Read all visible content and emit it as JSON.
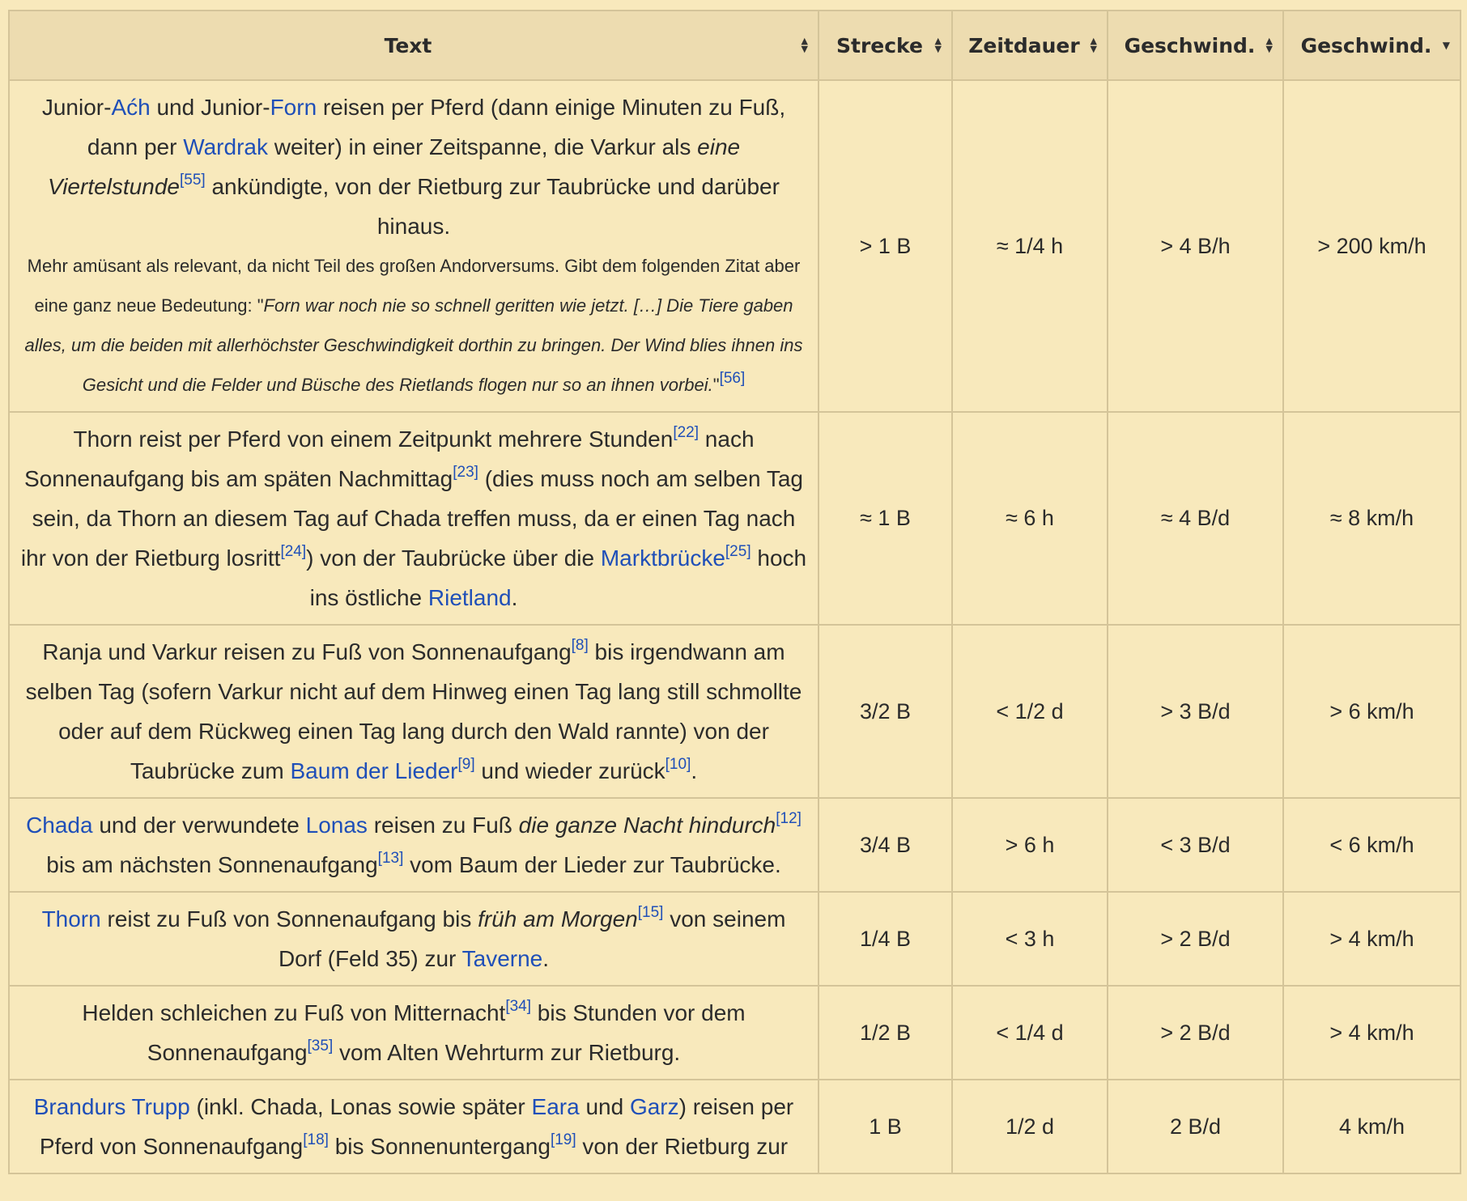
{
  "headers": [
    {
      "label": "Text",
      "sort": "both"
    },
    {
      "label": "Strecke",
      "sort": "both"
    },
    {
      "label": "Zeitdauer",
      "sort": "both"
    },
    {
      "label": "Geschwind.",
      "sort": "both"
    },
    {
      "label": "Geschwind.",
      "sort": "desc"
    }
  ],
  "sort_icons": {
    "both": "▲▼",
    "desc": "▼"
  },
  "rows": [
    {
      "text": [
        {
          "t": "Junior-"
        },
        {
          "t": "Aćh",
          "link": true
        },
        {
          "t": " und Junior-"
        },
        {
          "t": "Forn",
          "link": true
        },
        {
          "t": " reisen per Pferd (dann einige Minuten zu Fuß, dann per "
        },
        {
          "t": "Wardrak",
          "link": true
        },
        {
          "t": " weiter) in einer Zeitspanne, die Varkur als "
        },
        {
          "t": "eine Viertelstunde",
          "em": true
        },
        {
          "t": "[55]",
          "sup": true
        },
        {
          "t": " ankündigte, von der Rietburg zur Taubrücke und darüber hinaus."
        }
      ],
      "note": [
        {
          "t": "Mehr amüsant als relevant, da nicht Teil des großen Andorversums. Gibt dem folgenden Zitat aber eine ganz neue Bedeutung: \""
        },
        {
          "t": "Forn war noch nie so schnell geritten wie jetzt. […] Die Tiere gaben alles, um die beiden mit allerhöchster Geschwindigkeit dorthin zu bringen. Der Wind blies ihnen ins Gesicht und die Felder und Büsche des Rietlands flogen nur so an ihnen vorbei.",
          "em": true
        },
        {
          "t": "\""
        },
        {
          "t": "[56]",
          "sup": true
        }
      ],
      "strecke": "> 1 B",
      "zeit": "≈ 1/4 h",
      "speed1": "> 4 B/h",
      "speed2": "> 200 km/h"
    },
    {
      "text": [
        {
          "t": "Thorn reist per Pferd von einem Zeitpunkt mehrere Stunden"
        },
        {
          "t": "[22]",
          "sup": true
        },
        {
          "t": " nach Sonnenaufgang bis am späten Nachmittag"
        },
        {
          "t": "[23]",
          "sup": true
        },
        {
          "t": " (dies muss noch am selben Tag sein, da Thorn an diesem Tag auf Chada treffen muss, da er einen Tag nach ihr von der Rietburg losritt"
        },
        {
          "t": "[24]",
          "sup": true
        },
        {
          "t": ") von der Taubrücke über die "
        },
        {
          "t": "Marktbrücke",
          "link": true
        },
        {
          "t": "[25]",
          "sup": true
        },
        {
          "t": " hoch ins östliche "
        },
        {
          "t": "Rietland",
          "link": true
        },
        {
          "t": "."
        }
      ],
      "strecke": "≈ 1 B",
      "zeit": "≈ 6 h",
      "speed1": "≈ 4 B/d",
      "speed2": "≈ 8 km/h"
    },
    {
      "text": [
        {
          "t": "Ranja und Varkur reisen zu Fuß von Sonnenaufgang"
        },
        {
          "t": "[8]",
          "sup": true
        },
        {
          "t": " bis irgendwann am selben Tag (sofern Varkur nicht auf dem Hinweg einen Tag lang still schmollte oder auf dem Rückweg einen Tag lang durch den Wald rannte) von der Taubrücke zum "
        },
        {
          "t": "Baum der Lieder",
          "link": true
        },
        {
          "t": "[9]",
          "sup": true
        },
        {
          "t": " und wieder zurück"
        },
        {
          "t": "[10]",
          "sup": true
        },
        {
          "t": "."
        }
      ],
      "strecke": "3/2 B",
      "zeit": "< 1/2 d",
      "speed1": "> 3 B/d",
      "speed2": "> 6 km/h"
    },
    {
      "text": [
        {
          "t": "Chada",
          "link": true
        },
        {
          "t": " und der verwundete "
        },
        {
          "t": "Lonas",
          "link": true
        },
        {
          "t": " reisen zu Fuß "
        },
        {
          "t": "die ganze Nacht hindurch",
          "em": true
        },
        {
          "t": "[12]",
          "sup": true
        },
        {
          "t": " bis am nächsten Sonnenaufgang"
        },
        {
          "t": "[13]",
          "sup": true
        },
        {
          "t": " vom Baum der Lieder zur Taubrücke."
        }
      ],
      "strecke": "3/4 B",
      "zeit": "> 6 h",
      "speed1": "< 3 B/d",
      "speed2": "< 6 km/h"
    },
    {
      "text": [
        {
          "t": "Thorn",
          "link": true
        },
        {
          "t": " reist zu Fuß von Sonnenaufgang bis "
        },
        {
          "t": "früh am Morgen",
          "em": true
        },
        {
          "t": "[15]",
          "sup": true
        },
        {
          "t": " von seinem Dorf (Feld 35) zur "
        },
        {
          "t": "Taverne",
          "link": true
        },
        {
          "t": "."
        }
      ],
      "strecke": "1/4 B",
      "zeit": "< 3 h",
      "speed1": "> 2 B/d",
      "speed2": "> 4 km/h"
    },
    {
      "text": [
        {
          "t": "Helden schleichen zu Fuß von Mitternacht"
        },
        {
          "t": "[34]",
          "sup": true
        },
        {
          "t": " bis Stunden vor dem Sonnenaufgang"
        },
        {
          "t": "[35]",
          "sup": true
        },
        {
          "t": " vom Alten Wehrturm zur Rietburg."
        }
      ],
      "strecke": "1/2 B",
      "zeit": "< 1/4 d",
      "speed1": "> 2 B/d",
      "speed2": "> 4 km/h"
    },
    {
      "text": [
        {
          "t": "Brandurs Trupp",
          "link": true
        },
        {
          "t": " (inkl. Chada, Lonas sowie später "
        },
        {
          "t": "Eara",
          "link": true
        },
        {
          "t": " und "
        },
        {
          "t": "Garz",
          "link": true
        },
        {
          "t": ") reisen per Pferd von Sonnenaufgang"
        },
        {
          "t": "[18]",
          "sup": true
        },
        {
          "t": " bis Sonnenuntergang"
        },
        {
          "t": "[19]",
          "sup": true
        },
        {
          "t": " von der Rietburg zur"
        }
      ],
      "strecke": "1 B",
      "zeit": "1/2 d",
      "speed1": "2 B/d",
      "speed2": "4 km/h"
    }
  ]
}
